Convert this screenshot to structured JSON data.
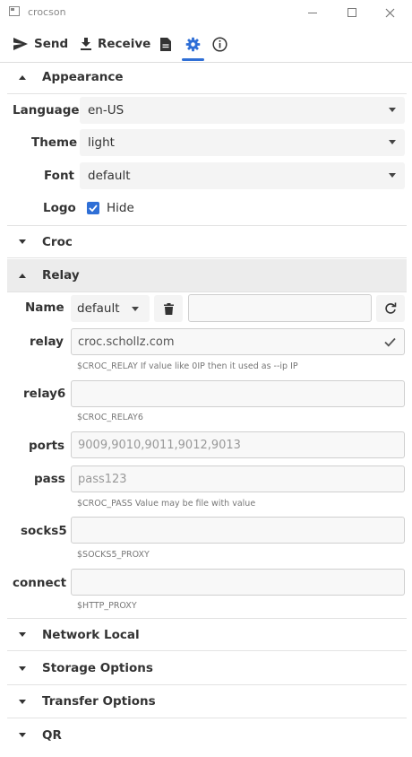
{
  "window": {
    "title": "crocson"
  },
  "toolbar": {
    "send_label": "Send",
    "receive_label": "Receive"
  },
  "sections": {
    "appearance": {
      "title": "Appearance",
      "language": {
        "label": "Language",
        "value": "en-US"
      },
      "theme": {
        "label": "Theme",
        "value": "light"
      },
      "font": {
        "label": "Font",
        "value": "default"
      },
      "logo": {
        "label": "Logo",
        "checkbox_label": "Hide",
        "checked": true
      }
    },
    "croc": {
      "title": "Croc"
    },
    "relay": {
      "title": "Relay",
      "name": {
        "label": "Name",
        "value": "default",
        "input_value": ""
      },
      "relay": {
        "label": "relay",
        "value": "croc.schollz.com",
        "hint": "$CROC_RELAY If value like 0IP then it used as --ip IP"
      },
      "relay6": {
        "label": "relay6",
        "value": "",
        "hint": "$CROC_RELAY6"
      },
      "ports": {
        "label": "ports",
        "value": "9009,9010,9011,9012,9013"
      },
      "pass": {
        "label": "pass",
        "value": "pass123",
        "hint": "$CROC_PASS Value may be file with value"
      },
      "socks5": {
        "label": "socks5",
        "value": "",
        "hint": "$SOCKS5_PROXY"
      },
      "connect": {
        "label": "connect",
        "value": "",
        "hint": "$HTTP_PROXY"
      }
    },
    "network_local": {
      "title": "Network Local"
    },
    "storage_options": {
      "title": "Storage Options"
    },
    "transfer_options": {
      "title": "Transfer Options"
    },
    "qr": {
      "title": "QR"
    }
  },
  "colors": {
    "accent": "#2f6fd6",
    "active_header": "#ececec"
  }
}
